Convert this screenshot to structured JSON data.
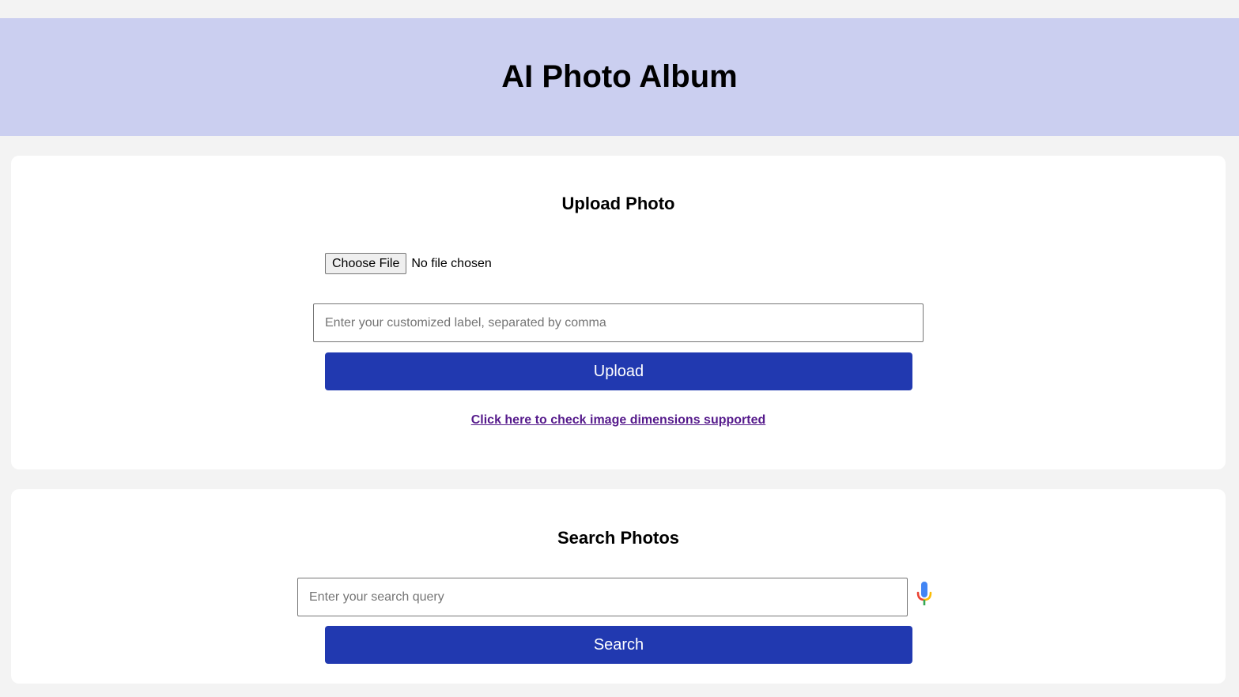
{
  "header": {
    "title": "AI Photo Album"
  },
  "upload_section": {
    "title": "Upload Photo",
    "choose_file_label": "Choose File",
    "file_status": "No file chosen",
    "label_input": {
      "value": "",
      "placeholder": "Enter your customized label, separated by comma"
    },
    "upload_button_label": "Upload",
    "dimensions_link_text": "Click here to check image dimensions supported"
  },
  "search_section": {
    "title": "Search Photos",
    "search_input": {
      "value": "",
      "placeholder": "Enter your search query"
    },
    "mic_icon": "microphone-icon",
    "search_button_label": "Search"
  },
  "colors": {
    "page_background": "#f3f3f3",
    "header_background": "#cbcff0",
    "card_background": "#ffffff",
    "primary_button": "#2139b0",
    "link_visited": "#551a8b",
    "mic_blue": "#4285f4",
    "mic_red": "#ea4335",
    "mic_yellow": "#fbbc05",
    "mic_green": "#34a853"
  }
}
